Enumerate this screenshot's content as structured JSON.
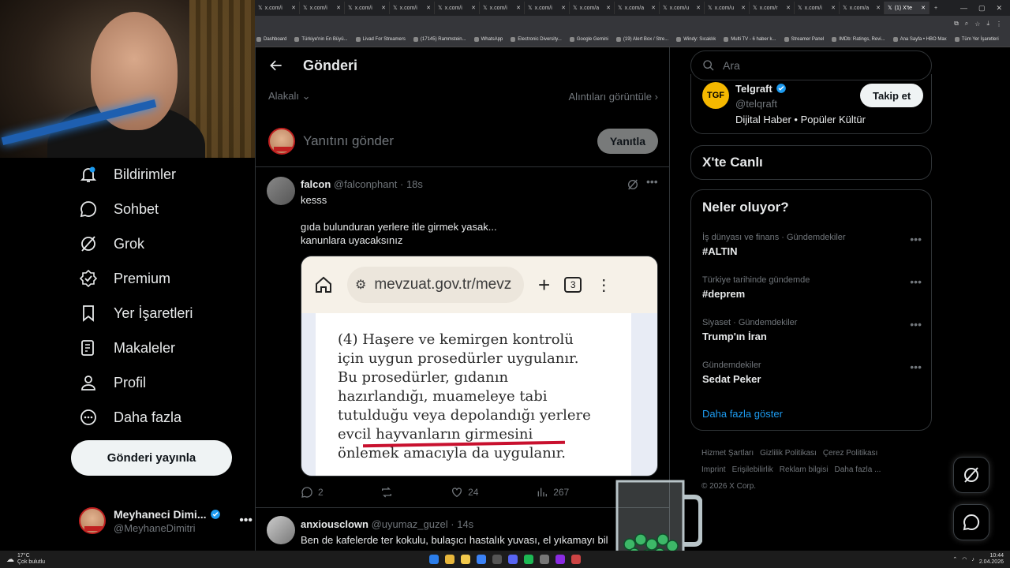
{
  "browser": {
    "tabs": [
      {
        "label": "x.com/i"
      },
      {
        "label": "x.com/i"
      },
      {
        "label": "x.com/i"
      },
      {
        "label": "x.com/i"
      },
      {
        "label": "x.com/i"
      },
      {
        "label": "x.com/i"
      },
      {
        "label": "x.com/i"
      },
      {
        "label": "x.com/a"
      },
      {
        "label": "x.com/a"
      },
      {
        "label": "x.com/u"
      },
      {
        "label": "x.com/u"
      },
      {
        "label": "x.com/r"
      },
      {
        "label": "x.com/i"
      },
      {
        "label": "x.com/a"
      },
      {
        "label": "(1) X'te"
      }
    ],
    "bookmarks": [
      "Dashboard",
      "Türkiye'nin En Büyü...",
      "Livad For Streamers",
      "(17145) Rammstein...",
      "WhatsApp",
      "Electronic Diversity...",
      "Google Gemini",
      "(19) Alert Box / Stre...",
      "Windy: Sıcaklık",
      "Multi TV - 6 haber k...",
      "Streamer Panel",
      "IMDb: Ratings, Revi...",
      "Ana Sayfa • HBO Max",
      "Tüm Yer İşaretleri"
    ]
  },
  "nav": {
    "items": [
      {
        "label": "Bildirimler",
        "icon": "bell-icon"
      },
      {
        "label": "Sohbet",
        "icon": "chat-icon"
      },
      {
        "label": "Grok",
        "icon": "grok-icon"
      },
      {
        "label": "Premium",
        "icon": "premium-icon"
      },
      {
        "label": "Yer İşaretleri",
        "icon": "bookmark-icon"
      },
      {
        "label": "Makaleler",
        "icon": "article-icon"
      },
      {
        "label": "Profil",
        "icon": "profile-icon"
      },
      {
        "label": "Daha fazla",
        "icon": "more-circle-icon"
      }
    ],
    "post_button": "Gönderi yayınla",
    "account": {
      "name": "Meyhaneci Dimi...",
      "handle": "@MeyhaneDimitri"
    }
  },
  "post": {
    "header_title": "Gönderi",
    "sort_label": "Alakalı",
    "quotes_link": "Alıntıları görüntüle",
    "reply_placeholder": "Yanıtını gönder",
    "reply_button": "Yanıtla"
  },
  "tweets": [
    {
      "name": "falcon",
      "handle": "@falconphant",
      "time": "18s",
      "text": "kesss\n\ngıda bulunduran yerlere itle girmek yasak...\nkanunlara uyacaksınız",
      "image": {
        "url": "mevzuat.gov.tr/mevz",
        "tab_count": "3",
        "text": "(4) Haşere ve kemirgen kontrolü\niçin uygun prosedürler uygulanır.\nBu prosedürler, gıdanın\nhazırlandığı, muameleye tabi\ntutulduğu veya depolandığı yerlere\nevcil hayvanların girmesini\nönlemek amacıyla da uygulanır."
      },
      "replies": "2",
      "likes": "24",
      "views": "267"
    },
    {
      "name": "anxiousclown",
      "handle": "@uyumaz_guzel",
      "time": "14s",
      "text": "Ben de kafelerde ter kokulu, bulaşıcı hastalık yuvası, el yıkamayı bil"
    }
  ],
  "right": {
    "search_placeholder": "Ara",
    "follow": {
      "name": "Telgraft",
      "handle": "@telqraft",
      "bio": "Dijital Haber • Popüler Kültür",
      "button": "Takip et",
      "logo": "TGF"
    },
    "live_title": "X'te Canlı",
    "trends_title": "Neler oluyor?",
    "trends": [
      {
        "category": "İş dünyası ve finans · Gündemdekiler",
        "title": "#ALTIN"
      },
      {
        "category": "Türkiye tarihinde gündemde",
        "title": "#deprem"
      },
      {
        "category": "Siyaset · Gündemdekiler",
        "title": "Trump'ın İran"
      },
      {
        "category": "Gündemdekiler",
        "title": "Sedat Peker"
      }
    ],
    "show_more": "Daha fazla göster",
    "footer": [
      "Hizmet Şartları",
      "Gizlilik Politikası",
      "Çerez Politikası",
      "Imprint",
      "Erişilebilirlik",
      "Reklam bilgisi",
      "Daha fazla ...",
      "© 2026 X Corp."
    ]
  },
  "taskbar": {
    "weather_temp": "17°C",
    "weather_desc": "Çok bulutlu",
    "time": "10:44",
    "date": "2.04.2026"
  },
  "colors": {
    "accent": "#1d9bf0",
    "background": "#000000",
    "muted": "#71767b",
    "underline": "#c8102e"
  }
}
